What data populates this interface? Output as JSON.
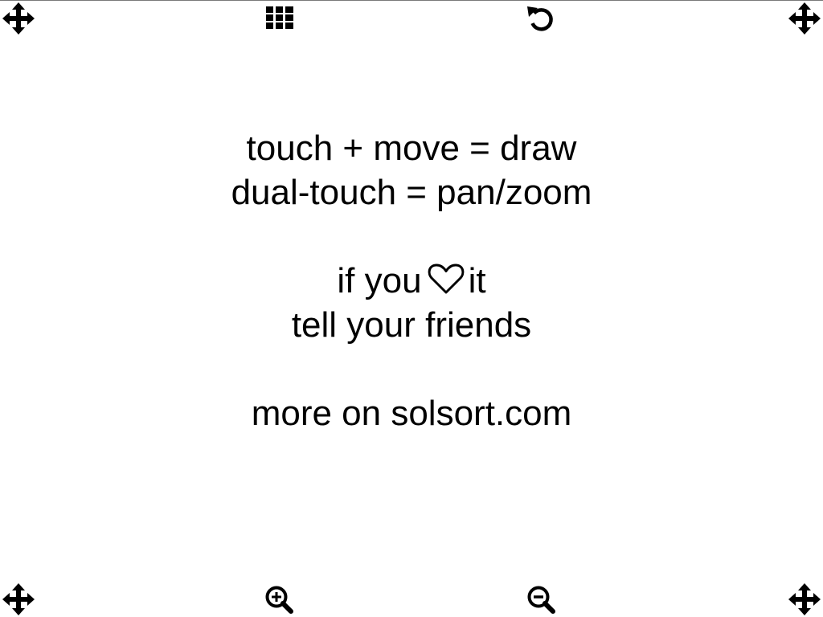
{
  "instructions": {
    "line1": "touch + move = draw",
    "line2": "dual-touch = pan/zoom",
    "line3_before": "if you",
    "line3_icon": "heart-icon",
    "line3_after": "it",
    "line4": "tell your friends",
    "line5": "more on solsort.com"
  },
  "toolbar": {
    "top": [
      "move-icon",
      "grid-menu-icon",
      "undo-icon",
      "move-icon"
    ],
    "bottom": [
      "move-icon",
      "zoom-in-icon",
      "zoom-out-icon",
      "move-icon"
    ]
  },
  "colors": {
    "background": "#ffffff",
    "foreground": "#000000",
    "top_border": "#7a7a7a"
  }
}
